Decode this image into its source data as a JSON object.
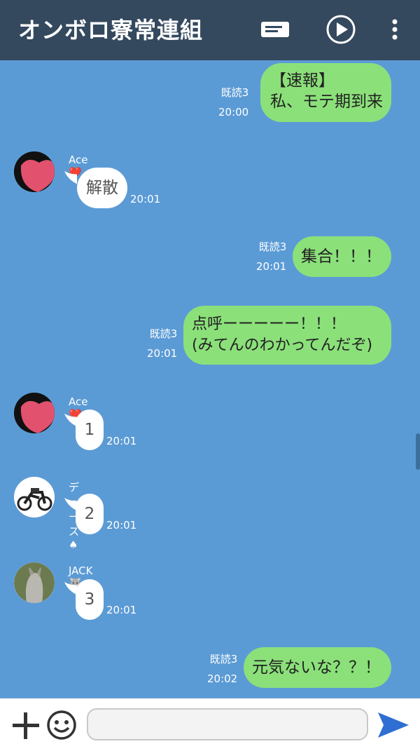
{
  "header": {
    "title": "オンボロ寮常連組",
    "icons": [
      "notes-icon",
      "play-icon",
      "more-vertical-icon"
    ]
  },
  "messages": [
    {
      "type": "outgoing",
      "lines": [
        "【速報】",
        "私、モテ期到来"
      ],
      "read": "既読3",
      "time": "20:00"
    },
    {
      "type": "incoming",
      "sender": "Ace",
      "sender_emoji": "❤️",
      "text": "解散",
      "time": "20:01"
    },
    {
      "type": "outgoing",
      "lines": [
        "集合！！！"
      ],
      "read": "既読3",
      "time": "20:01"
    },
    {
      "type": "outgoing",
      "lines": [
        "点呼ーーーーー！！！",
        "(みてんのわかってんだぞ)"
      ],
      "read": "既読3",
      "time": "20:01"
    },
    {
      "type": "incoming",
      "sender": "Ace",
      "sender_emoji": "❤️",
      "text": "1",
      "time": "20:01"
    },
    {
      "type": "incoming",
      "sender": "デュース",
      "sender_emoji": "♠",
      "text": "2",
      "time": "20:01"
    },
    {
      "type": "incoming",
      "sender": "JACK",
      "sender_emoji": "🐺",
      "text": "3",
      "time": "20:01"
    },
    {
      "type": "outgoing",
      "lines": [
        "元気ないな？？！"
      ],
      "read": "既読3",
      "time": "20:02"
    }
  ],
  "footer": {
    "input_value": "",
    "icons": [
      "plus-icon",
      "emoji-icon",
      "send-icon"
    ]
  },
  "colors": {
    "header": "#34495e",
    "background": "#5b9bd5",
    "outgoing": "#8be07a",
    "incoming": "#ffffff",
    "send": "#2f6fd3"
  }
}
